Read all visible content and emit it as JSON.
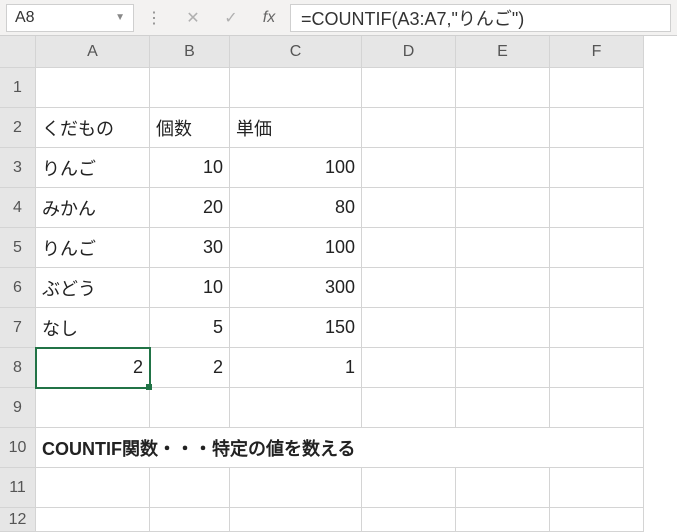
{
  "name_box": "A8",
  "formula": "=COUNTIF(A3:A7,\"りんご\")",
  "fx_label": "fx",
  "columns": [
    "A",
    "B",
    "C",
    "D",
    "E",
    "F"
  ],
  "rows": [
    "1",
    "2",
    "3",
    "4",
    "5",
    "6",
    "7",
    "8",
    "9",
    "10",
    "11",
    "12"
  ],
  "cells": {
    "A2": "くだもの",
    "B2": "個数",
    "C2": "単価",
    "A3": "りんご",
    "B3": "10",
    "C3": "100",
    "A4": "みかん",
    "B4": "20",
    "C4": "80",
    "A5": "りんご",
    "B5": "30",
    "C5": "100",
    "A6": "ぶどう",
    "B6": "10",
    "C6": "300",
    "A7": "なし",
    "B7": "5",
    "C7": "150",
    "A8": "2",
    "B8": "2",
    "C8": "1",
    "A10": "COUNTIF関数・・・特定の値を数える"
  },
  "active_cell": "A8"
}
